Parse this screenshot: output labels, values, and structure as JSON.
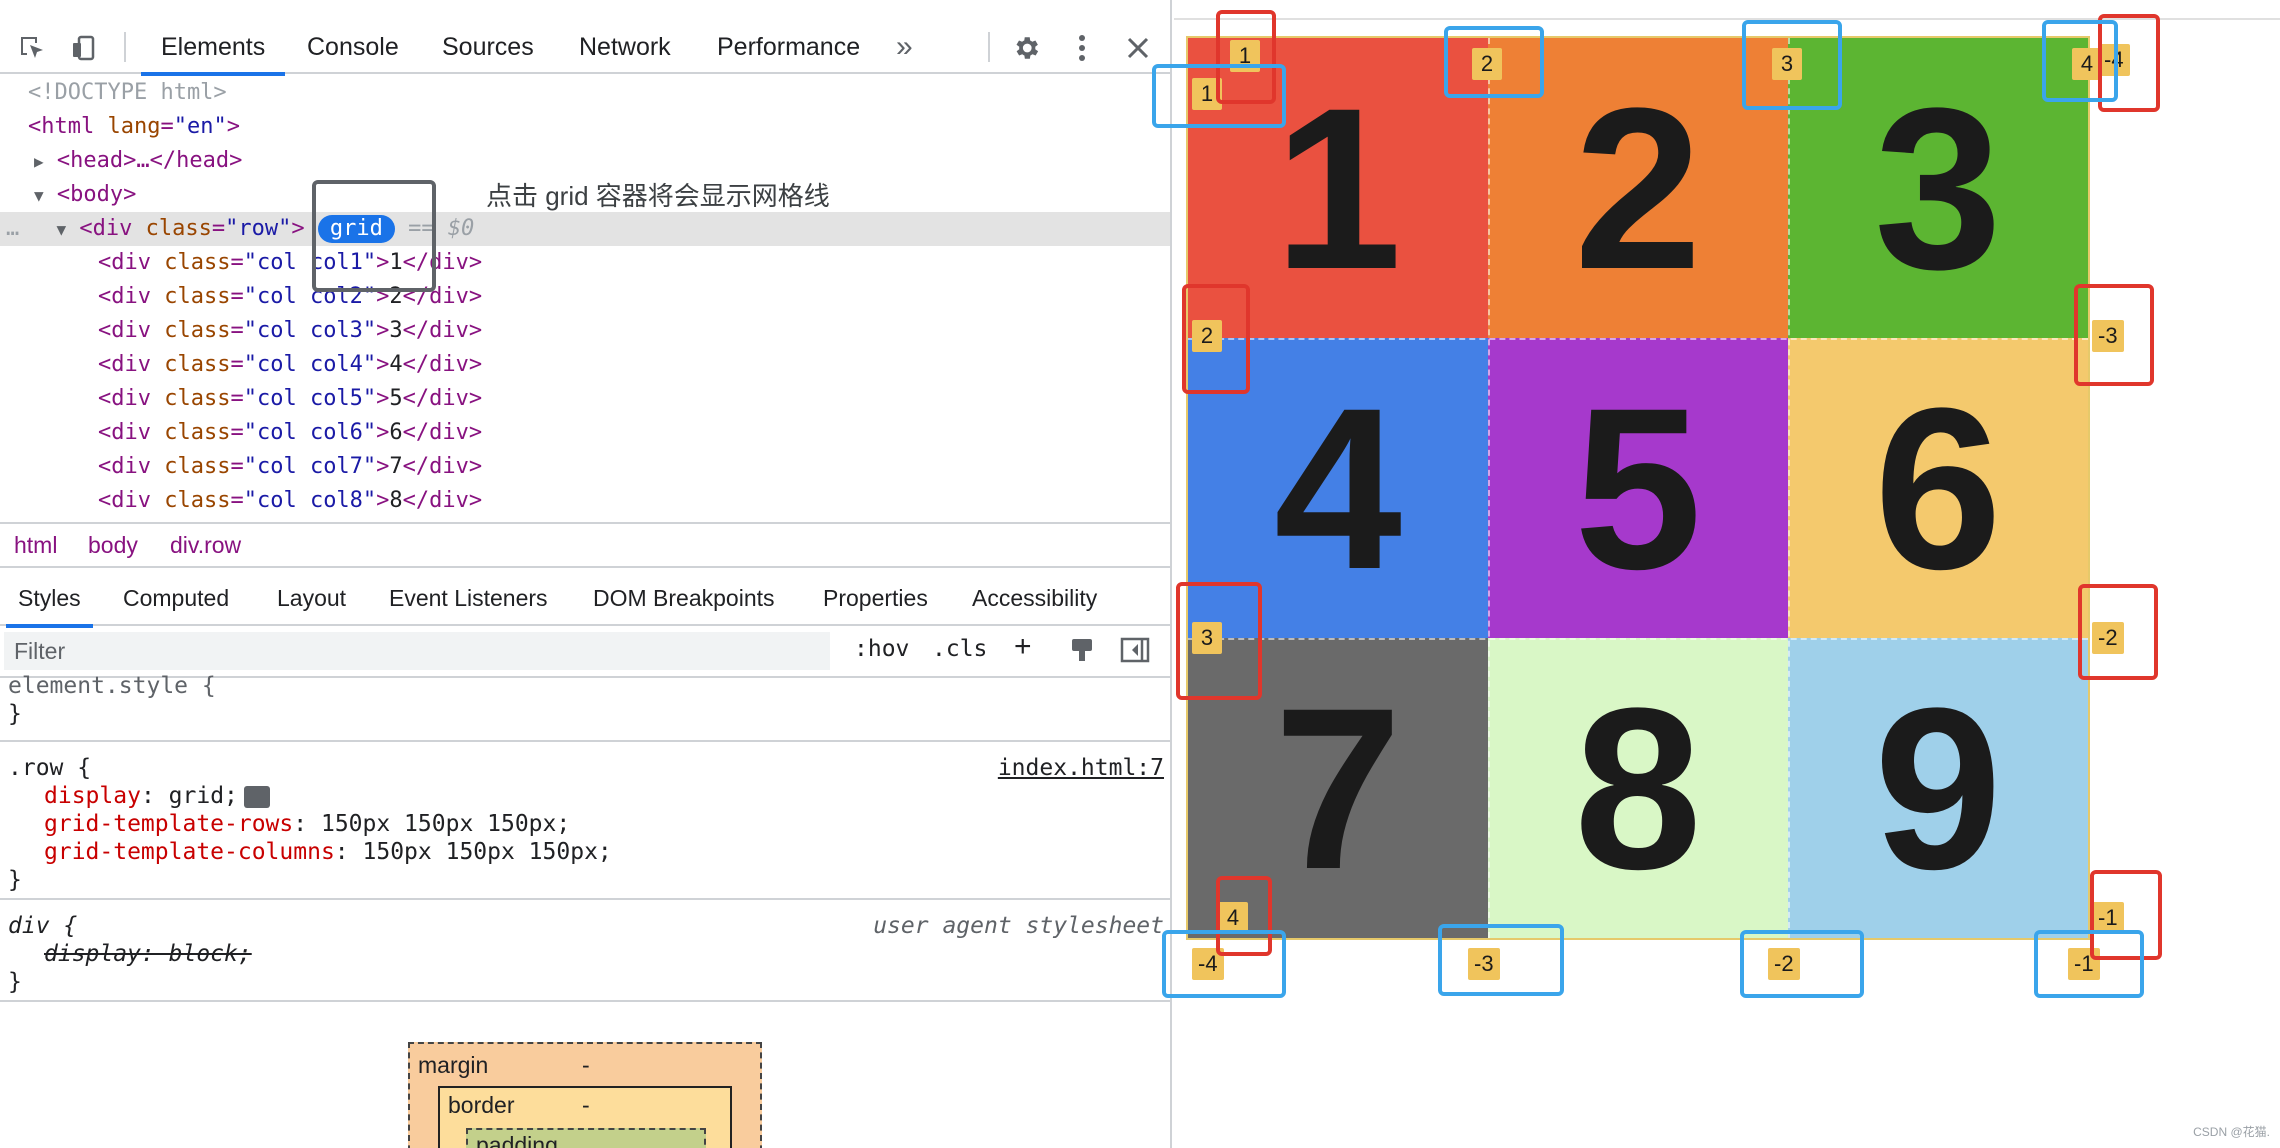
{
  "devtools": {
    "tabs": [
      "Elements",
      "Console",
      "Sources",
      "Network",
      "Performance"
    ],
    "more_tabs": "»",
    "dom": {
      "doctype": "<!DOCTYPE html>",
      "html_open_tag": "<html",
      "html_attr": "lang",
      "html_attr_val": "\"en\"",
      "html_close": ">",
      "head_line": "<head>…</head>",
      "body_open": "<body>",
      "div_open": "<div",
      "class_attr": "class",
      "row_val": "\"row\"",
      "gt": ">",
      "grid_badge": "grid",
      "eq_dollar": "== $0",
      "children": [
        {
          "cls": "\"col col1\"",
          "text": "1"
        },
        {
          "cls": "\"col col2\"",
          "text": "2"
        },
        {
          "cls": "\"col col3\"",
          "text": "3"
        },
        {
          "cls": "\"col col4\"",
          "text": "4"
        },
        {
          "cls": "\"col col5\"",
          "text": "5"
        },
        {
          "cls": "\"col col6\"",
          "text": "6"
        },
        {
          "cls": "\"col col7\"",
          "text": "7"
        },
        {
          "cls": "\"col col8\"",
          "text": "8"
        }
      ],
      "div_close": "</div>",
      "ellipsis": "…"
    },
    "annotation": "点击 grid 容器将会显示网格线",
    "breadcrumbs": [
      "html",
      "body",
      "div.row"
    ],
    "subtabs": [
      "Styles",
      "Computed",
      "Layout",
      "Event Listeners",
      "DOM Breakpoints",
      "Properties",
      "Accessibility"
    ],
    "filter_placeholder": "Filter",
    "hov": ":hov",
    "cls": ".cls",
    "plus": "+",
    "styles": {
      "element_style": "element.style {",
      "close_brace": "}",
      "row_selector": ".row {",
      "row_source": "index.html:7",
      "props": [
        {
          "name": "display",
          "value": "grid;"
        },
        {
          "name": "grid-template-rows",
          "value": "150px 150px 150px;"
        },
        {
          "name": "grid-template-columns",
          "value": "150px 150px 150px;"
        }
      ],
      "div_selector": "div {",
      "div_source": "user agent stylesheet",
      "div_prop": "display: block;",
      "colon": ":"
    },
    "box_model": {
      "margin_label": "margin",
      "margin_val": "-",
      "border_label": "border",
      "border_val": "-",
      "padding_label": "padding"
    }
  },
  "grid_page": {
    "cells": [
      {
        "label": "1",
        "color": "#ea5140"
      },
      {
        "label": "2",
        "color": "#ee8035"
      },
      {
        "label": "3",
        "color": "#5cb532"
      },
      {
        "label": "4",
        "color": "#4480e6"
      },
      {
        "label": "5",
        "color": "#a639cc"
      },
      {
        "label": "6",
        "color": "#f4c96d"
      },
      {
        "label": "7",
        "color": "#6a6a6a"
      },
      {
        "label": "8",
        "color": "#d9f7c6"
      },
      {
        "label": "9",
        "color": "#9fd0ea"
      }
    ],
    "line_labels": {
      "col_top": [
        "1",
        "2",
        "3",
        "4"
      ],
      "col_top_neg": "-4",
      "row_left": [
        "1",
        "2",
        "3",
        "4"
      ],
      "row_right": [
        "-3",
        "-2",
        "-1"
      ],
      "col_bottom": [
        "-4",
        "-3",
        "-2",
        "-1"
      ]
    },
    "accent_red": "#e0362c",
    "accent_blue": "#3aa5eb"
  },
  "watermark": "CSDN @花猫."
}
